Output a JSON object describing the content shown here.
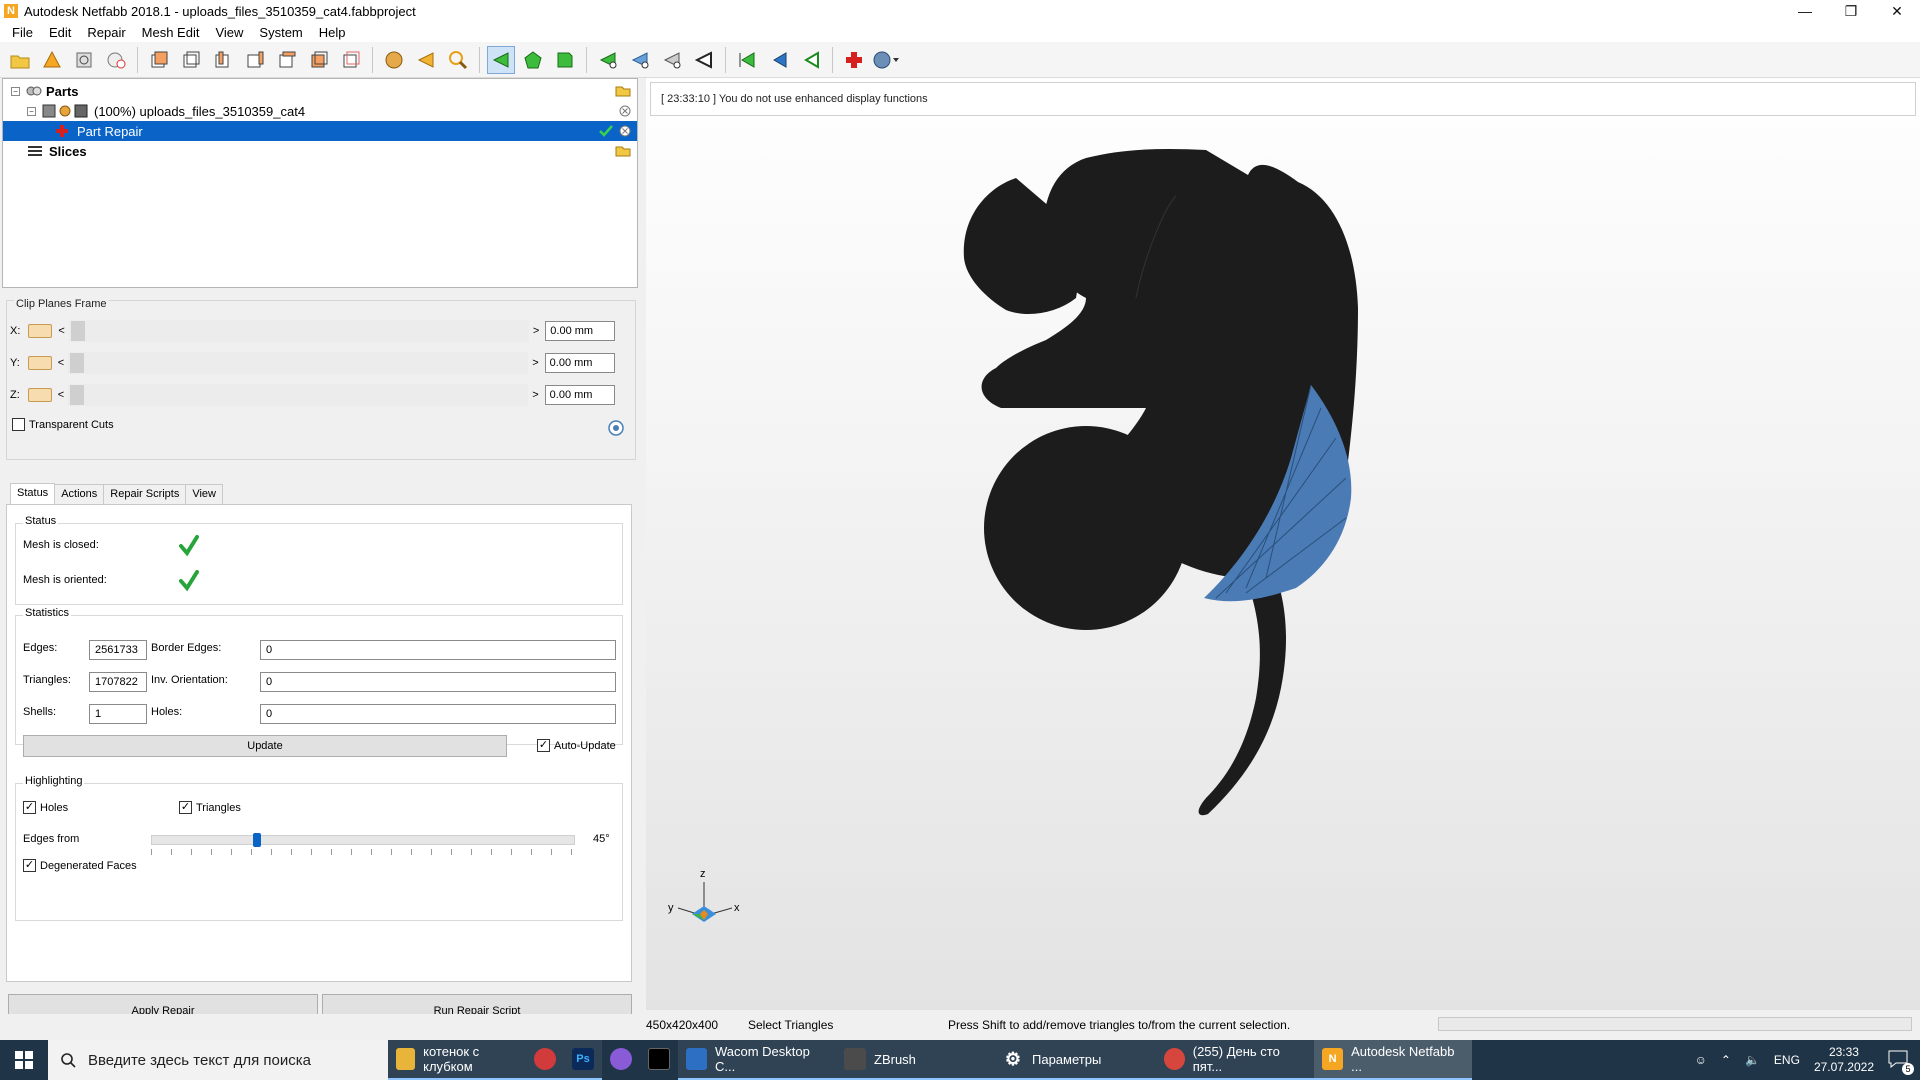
{
  "window": {
    "title": "Autodesk Netfabb 2018.1 - uploads_files_3510359_cat4.fabbproject",
    "controls": [
      "—",
      "❐",
      "✕"
    ]
  },
  "menu": [
    "File",
    "Edit",
    "Repair",
    "Mesh Edit",
    "View",
    "System",
    "Help"
  ],
  "tree": {
    "parts_label": "Parts",
    "part_name": "(100%) uploads_files_3510359_cat4",
    "repair_label": "Part Repair",
    "slices_label": "Slices"
  },
  "clip": {
    "title": "Clip Planes Frame",
    "x_label": "X:",
    "y_label": "Y:",
    "z_label": "Z:",
    "x_value": "0.00 mm",
    "y_value": "0.00 mm",
    "z_value": "0.00 mm",
    "transparent_label": "Transparent Cuts",
    "transparent_checked": false
  },
  "tabs": [
    "Status",
    "Actions",
    "Repair Scripts",
    "View"
  ],
  "status": {
    "title": "Status",
    "closed_label": "Mesh is closed:",
    "oriented_label": "Mesh is oriented:"
  },
  "stats": {
    "title": "Statistics",
    "edges_label": "Edges:",
    "edges": "2561733",
    "border_label": "Border Edges:",
    "border": "0",
    "triangles_label": "Triangles:",
    "triangles": "1707822",
    "inv_label": "Inv. Orientation:",
    "inv": "0",
    "shells_label": "Shells:",
    "shells": "1",
    "holes_label": "Holes:",
    "holes": "0",
    "update_button": "Update",
    "auto_update_label": "Auto-Update"
  },
  "highlighting": {
    "title": "Highlighting",
    "holes_label": "Holes",
    "triangles_label": "Triangles",
    "edges_from_label": "Edges from",
    "edges_from_value": "45°",
    "edges_from_level": 45,
    "degenerated_label": "Degenerated Faces"
  },
  "buttons": {
    "apply": "Apply Repair",
    "run_script": "Run Repair Script"
  },
  "log": "[ 23:33:10 ] You do not use enhanced display functions",
  "axis": {
    "x": "x",
    "y": "y",
    "z": "z"
  },
  "statusbar": {
    "dims": "450x420x400",
    "mode": "Select Triangles",
    "hint": "Press Shift to add/remove triangles to/from the current selection."
  },
  "taskbar": {
    "search_placeholder": "Введите здесь текст для поиска",
    "tasks": [
      {
        "label": "котенок с клубком",
        "color": "#e8b53a"
      },
      {
        "label": "",
        "color": "#d13b3b"
      },
      {
        "label": "Ps",
        "color": "#0b2a5a"
      },
      {
        "label": "",
        "color": "#8a5bd6"
      },
      {
        "label": "",
        "color": "#222222"
      },
      {
        "label": "Wacom Desktop C...",
        "color": "#2d6fc2"
      },
      {
        "label": "ZBrush",
        "color": "#4b4b4b"
      },
      {
        "label": "Параметры",
        "color": "#5a5a5a"
      },
      {
        "label": "(255) День сто пят...",
        "color": "#d7463c"
      },
      {
        "label": "Autodesk Netfabb ...",
        "color": "#f5a623"
      }
    ],
    "lang": "ENG",
    "time": "23:33",
    "date": "27.07.2022",
    "notification_count": "5"
  },
  "colors": {
    "selection": "#0a64c8",
    "check_green": "#27a53a",
    "mesh_dark": "#1c1c1c",
    "mesh_blue": "#4a7bb5"
  }
}
